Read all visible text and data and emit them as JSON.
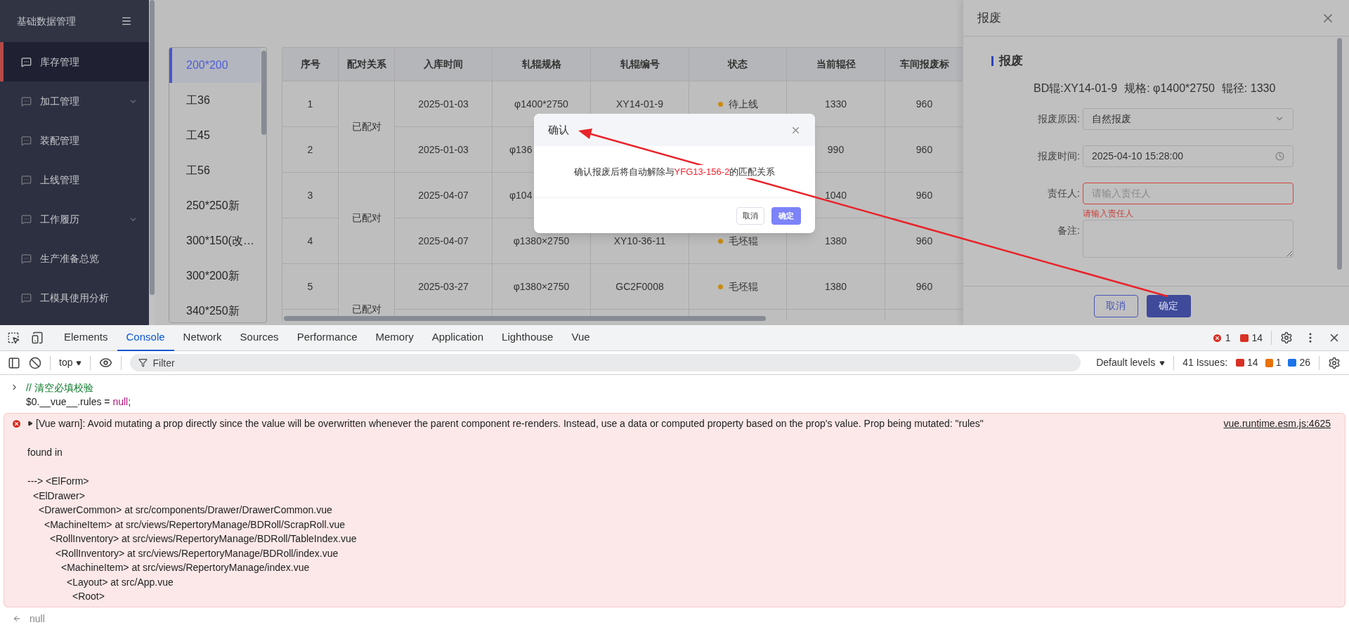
{
  "sidebar": {
    "title": "基础数据管理",
    "items": [
      {
        "label": "库存管理",
        "selected": true,
        "has_children": false
      },
      {
        "label": "加工管理",
        "selected": false,
        "has_children": true
      },
      {
        "label": "装配管理",
        "selected": false,
        "has_children": false
      },
      {
        "label": "上线管理",
        "selected": false,
        "has_children": false
      },
      {
        "label": "工作履历",
        "selected": false,
        "has_children": true
      },
      {
        "label": "生产准备总览",
        "selected": false,
        "has_children": false
      },
      {
        "label": "工模具使用分析",
        "selected": false,
        "has_children": false
      }
    ]
  },
  "categories": [
    {
      "label": "200*200",
      "selected": true
    },
    {
      "label": "工36",
      "selected": false
    },
    {
      "label": "工45",
      "selected": false
    },
    {
      "label": "工56",
      "selected": false
    },
    {
      "label": "250*250新",
      "selected": false
    },
    {
      "label": "300*150(改…",
      "selected": false
    },
    {
      "label": "300*200新",
      "selected": false
    },
    {
      "label": "340*250新",
      "selected": false
    }
  ],
  "table": {
    "columns": [
      "序号",
      "配对关系",
      "入库时间",
      "轧辊规格",
      "轧辊编号",
      "状态",
      "当前辊径",
      "车间报废标"
    ],
    "groups": [
      {
        "pairing": "已配对",
        "rows": [
          {
            "index": "1",
            "date": "2025-01-03",
            "spec": "φ1400*2750",
            "spec_clipped": false,
            "roll_no": "XY14-01-9",
            "status": "待上线",
            "diameter": "1330",
            "scrap_std": "960"
          },
          {
            "index": "2",
            "date": "2025-01-03",
            "spec": "φ136",
            "spec_clipped": true,
            "diameter": "990",
            "scrap_std": "960"
          }
        ]
      },
      {
        "pairing": "已配对",
        "rows": [
          {
            "index": "3",
            "date": "2025-04-07",
            "spec": "φ104",
            "spec_clipped": true,
            "diameter": "1040",
            "scrap_std": "960"
          },
          {
            "index": "4",
            "date": "2025-04-07",
            "spec": "φ1380×2750",
            "spec_clipped": false,
            "roll_no": "XY10-36-11",
            "status": "毛坯辊",
            "diameter": "1380",
            "scrap_std": "960"
          }
        ]
      },
      {
        "pairing": "已配对",
        "rows": [
          {
            "index": "5",
            "date": "2025-03-27",
            "spec": "φ1380×2750",
            "spec_clipped": false,
            "roll_no": "GC2F0008",
            "status": "毛坯辊",
            "diameter": "1380",
            "scrap_std": "960"
          }
        ]
      }
    ]
  },
  "confirm_dialog": {
    "title": "确认",
    "message": [
      {
        "kind": "plain",
        "text": "确认报废后将自动解除与"
      },
      {
        "kind": "highlight",
        "text": "YFG13-156-2"
      },
      {
        "kind": "plain",
        "text": "的匹配关系"
      }
    ],
    "buttons": [
      "取消",
      "确定"
    ]
  },
  "drawer": {
    "title": "报废",
    "section": "报废",
    "info": [
      "BD辊:XY14-01-9",
      "规格: φ1400*2750",
      "辊径: 1330"
    ],
    "fields": [
      {
        "kind": "select",
        "label": "报废原因:",
        "value": "自然报废",
        "invalid": false
      },
      {
        "kind": "datetime",
        "label": "报废时间:",
        "value": "2025-04-10 15:28:00",
        "invalid": false
      },
      {
        "kind": "text",
        "label": "责任人:",
        "placeholder": "请输入责任人",
        "invalid": true,
        "error": "请输入责任人"
      },
      {
        "kind": "textarea",
        "label": "备注:",
        "invalid": false
      }
    ],
    "buttons": [
      "取消",
      "确定"
    ]
  },
  "devtools": {
    "tabs": [
      {
        "label": "Elements",
        "selected": false
      },
      {
        "label": "Console",
        "selected": true
      },
      {
        "label": "Network",
        "selected": false
      },
      {
        "label": "Sources",
        "selected": false
      },
      {
        "label": "Performance",
        "selected": false
      },
      {
        "label": "Memory",
        "selected": false
      },
      {
        "label": "Application",
        "selected": false
      },
      {
        "label": "Lighthouse",
        "selected": false
      },
      {
        "label": "Vue",
        "selected": false
      }
    ],
    "error_count": "1",
    "warning_count": "14",
    "context": "top",
    "filter_placeholder": "Filter",
    "levels": "Default levels",
    "issues_label": "41 Issues:",
    "issue_counts": [
      "14",
      "1",
      "26"
    ]
  },
  "console": {
    "input": {
      "comment": "// 清空必填校验",
      "code": [
        {
          "kind": "plain",
          "text": "$0.__vue__.rules = "
        },
        {
          "kind": "keyword",
          "text": "null"
        },
        {
          "kind": "plain",
          "text": ";"
        }
      ]
    },
    "error": {
      "message": "[Vue warn]: Avoid mutating a prop directly since the value will be overwritten whenever the parent component re-renders. Instead, use a data or computed property based on the prop's value. Prop being mutated: \"rules\"",
      "source": "vue.runtime.esm.js:4625",
      "found_in": "found in",
      "stack": [
        {
          "text": "---> <ElForm>",
          "children": [
            {
              "text": "<ElDrawer>",
              "children": [
                {
                  "text": "<DrawerCommon> at src/components/Drawer/DrawerCommon.vue",
                  "children": [
                    {
                      "text": "<MachineItem> at src/views/RepertoryManage/BDRoll/ScrapRoll.vue",
                      "children": [
                        {
                          "text": "<RollInventory> at src/views/RepertoryManage/BDRoll/TableIndex.vue",
                          "children": [
                            {
                              "text": "<RollInventory> at src/views/RepertoryManage/BDRoll/index.vue",
                              "children": [
                                {
                                  "text": "<MachineItem> at src/views/RepertoryManage/index.vue",
                                  "children": [
                                    {
                                      "text": "<Layout> at src/App.vue",
                                      "children": [
                                        {
                                          "text": "<Root>"
                                        }
                                      ]
                                    }
                                  ]
                                }
                              ]
                            }
                          ]
                        }
                      ]
                    }
                  ]
                }
              ]
            }
          ]
        }
      ]
    },
    "result": "null"
  }
}
